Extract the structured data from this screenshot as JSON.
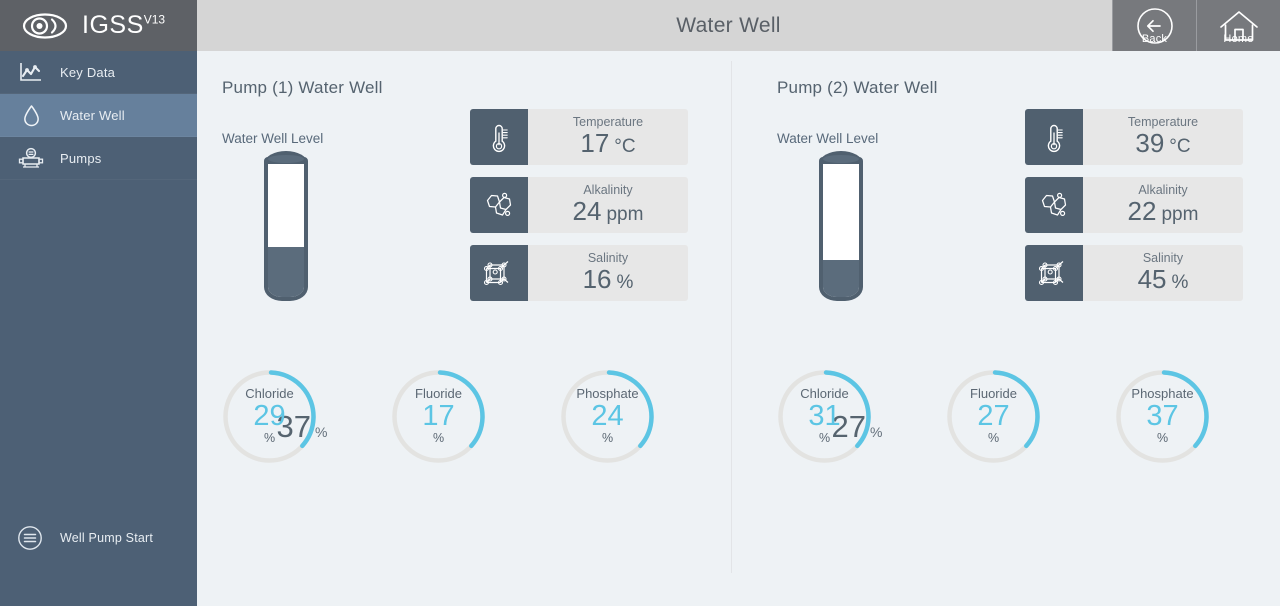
{
  "sidebar": {
    "logo": {
      "text": "IGSS",
      "superscript": "V13",
      "icon": "eye-icon"
    },
    "items": [
      {
        "label": "Key Data",
        "icon": "chart-icon",
        "active": false
      },
      {
        "label": "Water Well",
        "icon": "droplet-icon",
        "active": true
      },
      {
        "label": "Pumps",
        "icon": "pump-icon",
        "active": false
      }
    ],
    "action": {
      "label": "Well Pump Start",
      "icon": "menu-circle-icon"
    }
  },
  "topbar": {
    "title": "Water Well",
    "buttons": [
      {
        "label": "Back",
        "icon": "back-arrow-icon"
      },
      {
        "label": "Home",
        "icon": "home-icon"
      }
    ]
  },
  "panels": [
    {
      "title": "Pump (1) Water Well",
      "level": {
        "label": "Water Well Level",
        "value": "37",
        "unit": "%",
        "fill_percent": 37
      },
      "cards": [
        {
          "label": "Temperature",
          "value": "17",
          "unit": "°C",
          "icon": "thermometer-icon"
        },
        {
          "label": "Alkalinity",
          "value": "24",
          "unit": "ppm",
          "icon": "molecule-icon"
        },
        {
          "label": "Salinity",
          "value": "16",
          "unit": "%",
          "icon": "lattice-icon"
        }
      ],
      "gauges": [
        {
          "label": "Chloride",
          "value": "29",
          "unit": "%",
          "arc_percent": 36
        },
        {
          "label": "Fluoride",
          "value": "17",
          "unit": "%",
          "arc_percent": 36
        },
        {
          "label": "Phosphate",
          "value": "24",
          "unit": "%",
          "arc_percent": 36
        }
      ]
    },
    {
      "title": "Pump (2) Water Well",
      "level": {
        "label": "Water Well Level",
        "value": "27",
        "unit": "%",
        "fill_percent": 27
      },
      "cards": [
        {
          "label": "Temperature",
          "value": "39",
          "unit": "°C",
          "icon": "thermometer-icon"
        },
        {
          "label": "Alkalinity",
          "value": "22",
          "unit": "ppm",
          "icon": "molecule-icon"
        },
        {
          "label": "Salinity",
          "value": "45",
          "unit": "%",
          "icon": "lattice-icon"
        }
      ],
      "gauges": [
        {
          "label": "Chloride",
          "value": "31",
          "unit": "%",
          "arc_percent": 36
        },
        {
          "label": "Fluoride",
          "value": "27",
          "unit": "%",
          "arc_percent": 36
        },
        {
          "label": "Phosphate",
          "value": "37",
          "unit": "%",
          "arc_percent": 36
        }
      ]
    }
  ],
  "colors": {
    "sidebar": "#4d6075",
    "sidebar_active": "#66809c",
    "logo_bar": "#5e6166",
    "topbar": "#d5d5d5",
    "topbar_button": "#77797d",
    "content_bg": "#eef2f5",
    "card_bg": "#e7e7e7",
    "icon_box": "#50606f",
    "accent_cyan": "#5cc5e4",
    "gauge_track": "#e3e3e1",
    "text_dark": "#55636f"
  }
}
